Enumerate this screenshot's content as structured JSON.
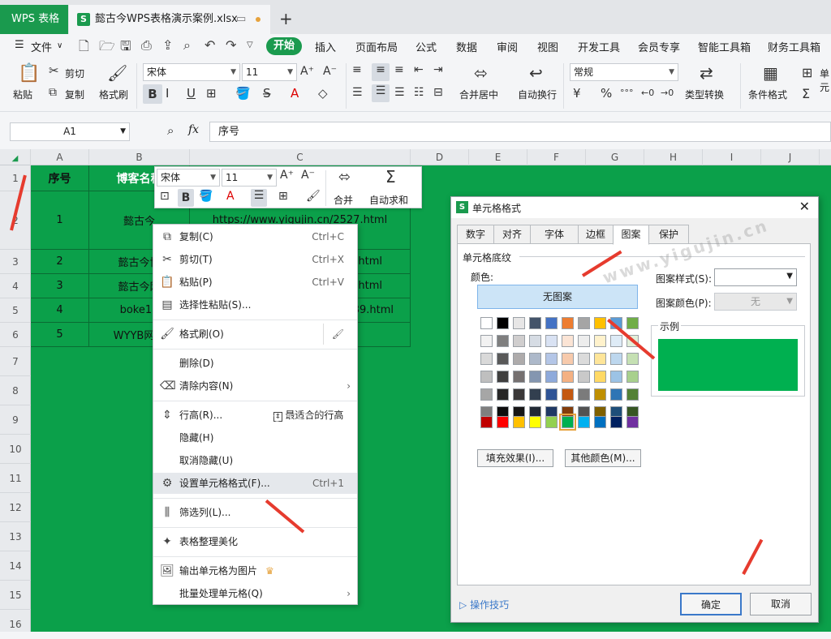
{
  "tabs": {
    "app": "WPS 表格",
    "doc": "懿古今WPS表格演示案例.xlsx",
    "new": "+"
  },
  "menu": {
    "file": "文件",
    "items": [
      "开始",
      "插入",
      "页面布局",
      "公式",
      "数据",
      "审阅",
      "视图",
      "开发工具",
      "会员专享",
      "智能工具箱",
      "财务工具箱"
    ]
  },
  "ribbon": {
    "paste": "粘贴",
    "cut": "剪切",
    "copy": "复制",
    "format_painter": "格式刷",
    "font": "宋体",
    "size": "11",
    "merge": "合并居中",
    "wrap": "自动换行",
    "numfmt": "常规",
    "convert": "类型转换",
    "cond": "条件格式",
    "more": "单元"
  },
  "fbar": {
    "cell": "A1",
    "fx": "fx",
    "content": "序号"
  },
  "cols": [
    "A",
    "B",
    "C",
    "D",
    "E",
    "F",
    "G",
    "H",
    "I",
    "J"
  ],
  "rows": [
    "1",
    "2",
    "3",
    "4",
    "5",
    "6",
    "7",
    "8",
    "9",
    "10",
    "11",
    "12",
    "13",
    "14",
    "15",
    "16"
  ],
  "table": {
    "h1": "序号",
    "h2": "博客名称",
    "r": [
      {
        "n": "1",
        "b": "懿古今",
        "c": "https://www.yigujin.cn/2527.html"
      },
      {
        "n": "2",
        "b": "懿古今博",
        "c": ".html"
      },
      {
        "n": "3",
        "b": "懿古今网",
        "c": ".html"
      },
      {
        "n": "4",
        "b": "boke11",
        "c": "39.html"
      },
      {
        "n": "5",
        "b": "WYYB网站",
        "c": ""
      }
    ]
  },
  "mini": {
    "font": "宋体",
    "size": "11",
    "merge": "合并",
    "autosum": "自动求和"
  },
  "ctx": [
    {
      "i": "⧉",
      "l": "复制(C)",
      "s": "Ctrl+C"
    },
    {
      "i": "✂",
      "l": "剪切(T)",
      "s": "Ctrl+X"
    },
    {
      "i": "📋",
      "l": "粘贴(P)",
      "s": "Ctrl+V"
    },
    {
      "i": "▤",
      "l": "选择性粘贴(S)...",
      "s": ""
    },
    {
      "i": "🖌",
      "l": "格式刷(O)",
      "s": ""
    },
    {
      "i": "",
      "l": "删除(D)",
      "s": ""
    },
    {
      "i": "⌫",
      "l": "清除内容(N)",
      "s": "›"
    },
    {
      "i": "⇕",
      "l": "行高(R)...",
      "s": ""
    },
    {
      "i": "",
      "l": "隐藏(H)",
      "s": ""
    },
    {
      "i": "",
      "l": "取消隐藏(U)",
      "s": ""
    },
    {
      "i": "⚙",
      "l": "设置单元格格式(F)...",
      "s": "Ctrl+1"
    },
    {
      "i": "⫼",
      "l": "筛选列(L)...",
      "s": ""
    },
    {
      "i": "✦",
      "l": "表格整理美化",
      "s": ""
    },
    {
      "i": "🖼",
      "l": "输出单元格为图片",
      "s": ""
    },
    {
      "i": "",
      "l": "批量处理单元格(Q)",
      "s": "›"
    }
  ],
  "ctx_extra": {
    "best_height": "最适合的行高"
  },
  "dlg": {
    "title": "单元格格式",
    "tabs": [
      "数字",
      "对齐",
      "字体",
      "边框",
      "图案",
      "保护"
    ],
    "section": "单元格底纹",
    "color": "颜色:",
    "nopattern": "无图案",
    "pstyle": "图案样式(S):",
    "pcolor": "图案颜色(P):",
    "none": "无",
    "sample": "示例",
    "fill": "填充效果(I)...",
    "other": "其他颜色(M)...",
    "tips": "操作技巧",
    "ok": "确定",
    "cancel": "取消"
  },
  "watermark": "www.yigujin.cn",
  "colors": {
    "accent": "#1a9a4e",
    "sheet": "#0ba04a",
    "sample": "#00b050",
    "arrow": "#e63b2e"
  }
}
